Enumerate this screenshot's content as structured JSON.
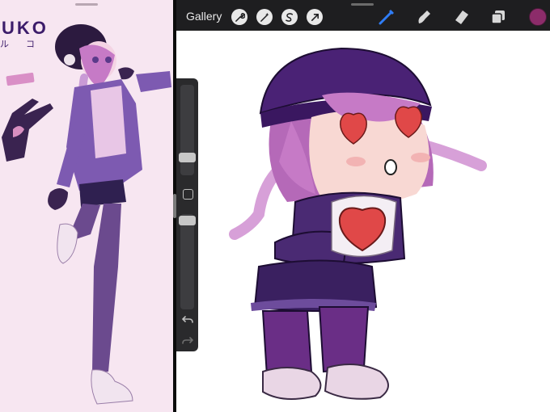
{
  "reference": {
    "title": "UKO",
    "subtitle": "ル コ"
  },
  "toolbar": {
    "gallery_label": "Gallery",
    "left_tools": [
      "wrench-icon",
      "magic-wand-icon",
      "selection-s-icon",
      "arrow-cursor-icon"
    ],
    "right_tools": [
      "brush-icon",
      "smudge-icon",
      "eraser-icon",
      "layers-icon"
    ],
    "active_tool": "brush-icon",
    "active_color": "#8c2c6a",
    "accent_color": "#2f7df6"
  }
}
